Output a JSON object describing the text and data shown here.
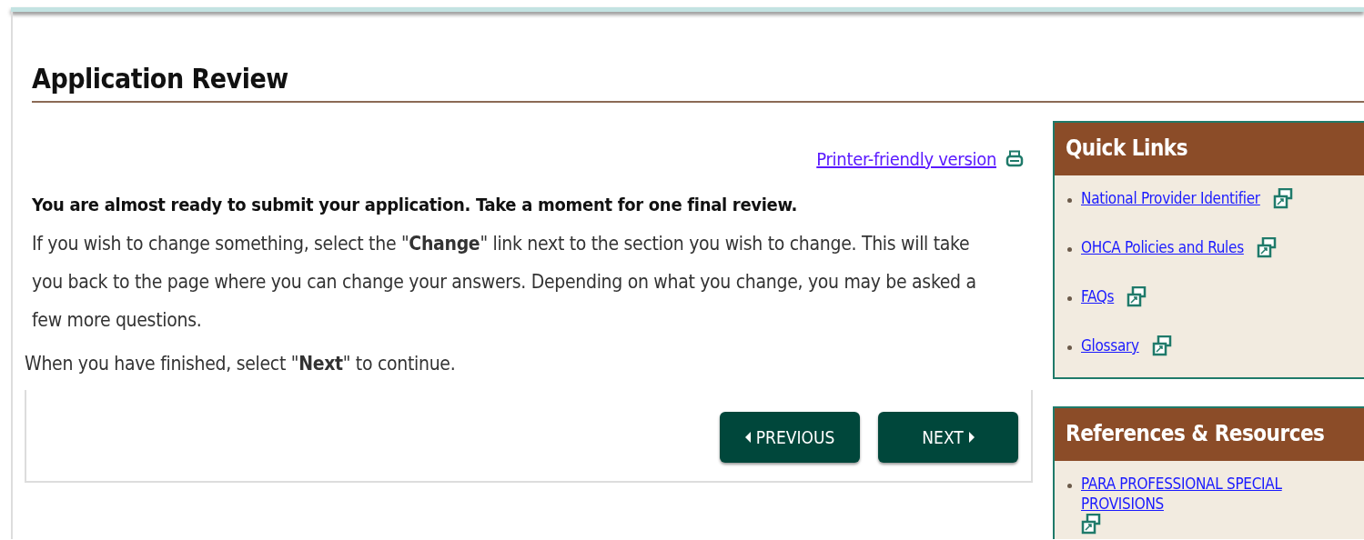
{
  "page": {
    "title": "Application Review"
  },
  "printer_link": {
    "label": "Printer-friendly version"
  },
  "intro": "You are almost ready to submit your application. Take a moment  for one final review.",
  "paragraphs": [
    {
      "text": "If you wish to change something, select the \"**Change**\" link next to the section you wish to change. This will take you back to the page where you can change your answers. Depending on what you change, you may be asked a few more questions.",
      "kind": "indented"
    },
    {
      "text": "When you have finished, select \"**Next**\" to continue.",
      "kind": "outdented"
    }
  ],
  "buttons": [
    {
      "label": "PREVIOUS",
      "kind": "previous"
    },
    {
      "label": "NEXT",
      "kind": "next"
    }
  ],
  "sidebar": [
    {
      "title": "Quick Links",
      "links": [
        "National Provider Identifier",
        "OHCA Policies and Rules",
        "FAQs",
        "Glossary"
      ]
    },
    {
      "title": "References & Resources",
      "links": [
        "PARA PROFESSIONAL SPECIAL PROVISIONS"
      ]
    }
  ]
}
